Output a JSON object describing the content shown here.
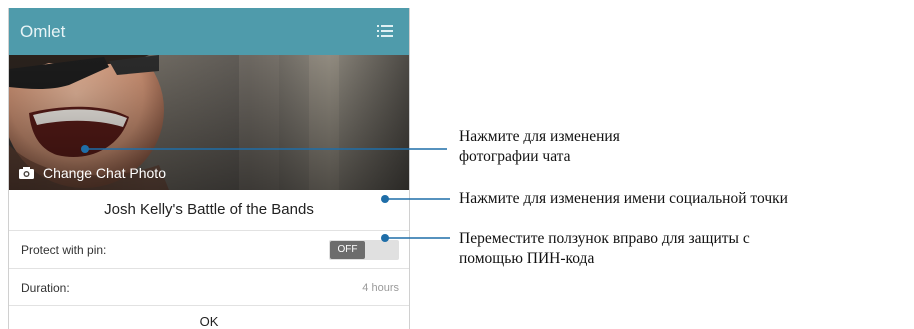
{
  "appbar": {
    "title": "Omlet",
    "menu_icon": "list-menu-icon"
  },
  "photo": {
    "caption": "Change Chat Photo",
    "camera_icon": "camera-icon"
  },
  "chat": {
    "name": "Josh Kelly's Battle of the Bands"
  },
  "pin": {
    "label": "Protect with pin:",
    "toggle_state": "OFF"
  },
  "duration": {
    "label": "Duration:",
    "value": "4 hours"
  },
  "ok": {
    "label": "OK"
  },
  "callouts": {
    "photo_line1": "Нажмите для изменения",
    "photo_line2": "фотографии чата",
    "name": "Нажмите для изменения имени социальной точки",
    "pin_line1": "Переместите ползунок вправо для защиты с",
    "pin_line2": "помощью ПИН-кода"
  },
  "colors": {
    "accent": "#4f9bab",
    "callout_line": "#1f6ea8"
  }
}
